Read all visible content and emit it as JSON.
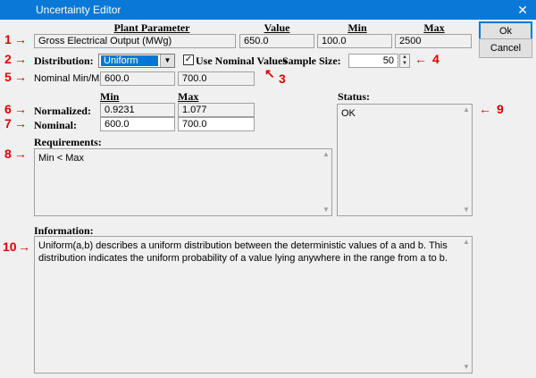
{
  "window": {
    "title": "Uncertainty Editor",
    "close_glyph": "✕"
  },
  "buttons": {
    "ok": "Ok",
    "cancel": "Cancel"
  },
  "headers": {
    "plant_parameter": "Plant Parameter",
    "value": "Value",
    "min": "Min",
    "max": "Max"
  },
  "parameter": {
    "name": "Gross Electrical Output (MWg)",
    "value": "650.0",
    "min": "100.0",
    "max": "2500"
  },
  "distribution": {
    "label": "Distribution:",
    "selected": "Uniform"
  },
  "use_nominal": {
    "label": "Use Nominal Values",
    "checked": true,
    "check_glyph": "✓"
  },
  "sample_size": {
    "label": "Sample Size:",
    "value": "50"
  },
  "nominal_minmax": {
    "label": "Nominal Min/Max:",
    "min": "600.0",
    "max": "700.0"
  },
  "sub_headers": {
    "min": "Min",
    "max": "Max"
  },
  "normalized": {
    "label": "Normalized:",
    "min": "0.9231",
    "max": "1.077"
  },
  "nominal": {
    "label": "Nominal:",
    "min": "600.0",
    "max": "700.0"
  },
  "requirements": {
    "label": "Requirements:",
    "text": "Min < Max"
  },
  "status": {
    "label": "Status:",
    "text": "OK"
  },
  "information": {
    "label": "Information:",
    "text": "Uniform(a,b) describes a uniform distribution between the deterministic values of a and b. This distribution indicates the uniform probability of a value lying anywhere in the range from a to b."
  },
  "annotations": {
    "n1": "1",
    "n2": "2",
    "n3": "3",
    "n4": "4",
    "n5": "5",
    "n6": "6",
    "n7": "7",
    "n8": "8",
    "n9": "9",
    "n10": "10",
    "arrow_right": "→",
    "arrow_left": "←",
    "arrow_upleft": "↖",
    "color": "#e00000"
  }
}
